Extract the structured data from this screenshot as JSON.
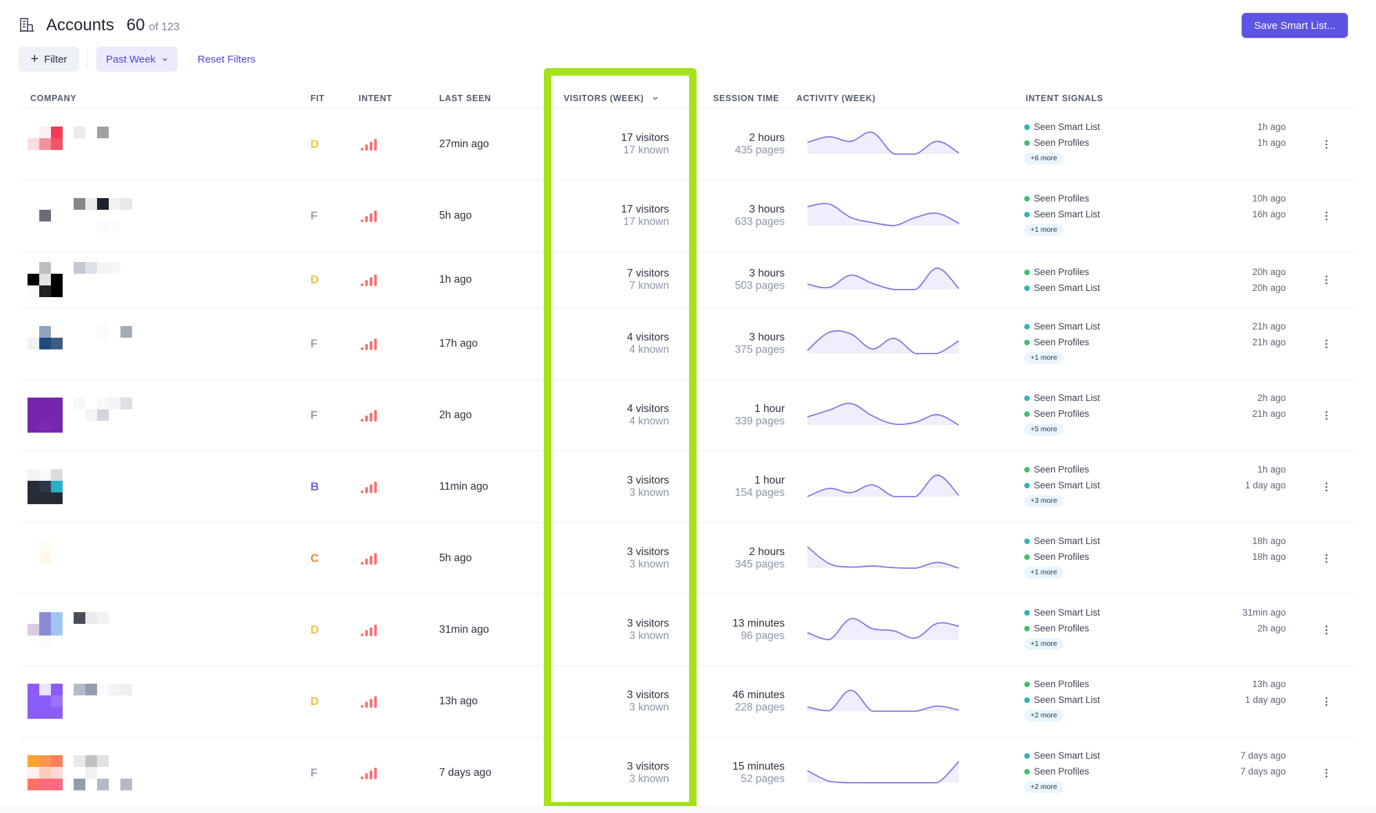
{
  "header": {
    "icon": "building-icon",
    "title": "Accounts",
    "count": "60",
    "count_of": "of 123",
    "save_button": "Save Smart List..."
  },
  "filters": {
    "add_filter_label": "Filter",
    "add_filter_icon": "plus-icon",
    "period_label": "Past Week",
    "period_icon": "chevron-down-icon",
    "reset_label": "Reset Filters"
  },
  "columns": {
    "company": "COMPANY",
    "fit": "FIT",
    "intent": "INTENT",
    "last_seen": "LAST SEEN",
    "visitors": "VISITORS (WEEK)",
    "session_time": "SESSION TIME",
    "activity": "ACTIVITY (WEEK)",
    "intent_signals": "INTENT SIGNALS"
  },
  "colors": {
    "accent": "#5d54e4",
    "highlight": "#a6e11e",
    "sparkline_line": "#7c78e6",
    "sparkline_fill": "#efeefc",
    "intent_bars": "#f87171",
    "fit_D": "#ecc53f",
    "fit_F": "#9aa3b2",
    "fit_B": "#6c63ea",
    "fit_C": "#ef8a3a",
    "signal_smart_list": "#2db5b5",
    "signal_profiles": "#3fbf6a"
  },
  "rows": [
    {
      "logo": [
        "#ffffff",
        "#fdeff1",
        "#f43a55",
        "#fbdce1",
        "#f58f9c",
        "#f25366",
        "#ffffff",
        "#ffffff",
        "#ffffff"
      ],
      "name": [
        "#eaebeb",
        "#ffffff",
        "#a0a1a5",
        "#ffffff",
        "#ffffff",
        "#ffffff",
        "#ffffff",
        "#ffffff",
        "#ffffff",
        "#ffffff",
        "#ffffff",
        "#ffffff",
        "#ffffff",
        "#ffffff",
        "#ffffff"
      ],
      "fit": "D",
      "last_seen": "27min ago",
      "visitors": "17 visitors",
      "known": "17 known",
      "session": "2 hours",
      "pages": "435 pages",
      "activity": [
        0.53,
        0.79,
        0.58,
        0.98,
        0,
        0,
        0.58,
        0.05
      ],
      "signals": [
        {
          "label": "Seen Smart List",
          "type": "smart_list",
          "when": "1h ago"
        },
        {
          "label": "Seen Profiles",
          "type": "profiles",
          "when": "1h ago"
        }
      ],
      "more": "+6 more"
    },
    {
      "logo": [
        "#ffffff",
        "#ffffff",
        "#ffffff",
        "#ffffff",
        "#6b6c78",
        "#ffffff",
        "#ffffff",
        "#ffffff",
        "#ffffff"
      ],
      "name": [
        "#86878c",
        "#eaebeb",
        "#1e2230",
        "#f0f1f3",
        "#e6e7e8",
        "#ffffff",
        "#ffffff",
        "#ffffff",
        "#ffffff",
        "#ffffff",
        "#ffffff",
        "#ffffff",
        "#fbfbfb",
        "#fbfcfb",
        "#ffffff"
      ],
      "fit": "F",
      "last_seen": "5h ago",
      "visitors": "17 visitors",
      "known": "17 known",
      "session": "3 hours",
      "pages": "633 pages",
      "activity": [
        0.86,
        0.98,
        0.37,
        0.14,
        0,
        0.37,
        0.56,
        0.1
      ],
      "signals": [
        {
          "label": "Seen Profiles",
          "type": "profiles",
          "when": "10h ago"
        },
        {
          "label": "Seen Smart List",
          "type": "smart_list",
          "when": "16h ago"
        }
      ],
      "more": "+1 more"
    },
    {
      "logo": [
        "#ffffff",
        "#bdbdbd",
        "#ffffff",
        "#000000",
        "#e3e3e3",
        "#000000",
        "#fbfbfb",
        "#222222",
        "#000000"
      ],
      "name": [
        "#c3c8d2",
        "#dfe0e5",
        "#f3f4f6",
        "#f6f6f8",
        "#ffffff",
        "#ffffff",
        "#ffffff",
        "#ffffff",
        "#ffffff",
        "#ffffff",
        "#ffffff",
        "#ffffff",
        "#ffffff",
        "#ffffff",
        "#ffffff"
      ],
      "fit": "D",
      "last_seen": "1h ago",
      "visitors": "7 visitors",
      "known": "7 known",
      "session": "3 hours",
      "pages": "503 pages",
      "activity": [
        0.25,
        0.1,
        0.65,
        0.28,
        0,
        0,
        0.97,
        0.04
      ],
      "signals": [
        {
          "label": "Seen Profiles",
          "type": "profiles",
          "when": "20h ago"
        },
        {
          "label": "Seen Smart List",
          "type": "smart_list",
          "when": "20h ago"
        }
      ],
      "more": ""
    },
    {
      "logo": [
        "#ffffff",
        "#90a4be",
        "#ffffff",
        "#eff2f5",
        "#1c4c7e",
        "#435a80",
        "#ffffff",
        "#ffffff",
        "#ffffff"
      ],
      "name": [
        "#ffffff",
        "#ffffff",
        "#fafafa",
        "#ffffff",
        "#a6acba",
        "#ffffff",
        "#ffffff",
        "#ffffff",
        "#ffffff",
        "#ffffff",
        "#ffffff",
        "#ffffff",
        "#ffffff",
        "#ffffff",
        "#ffffff"
      ],
      "fit": "F",
      "last_seen": "17h ago",
      "visitors": "4 visitors",
      "known": "4 known",
      "session": "3 hours",
      "pages": "375 pages",
      "activity": [
        0.14,
        0.96,
        0.89,
        0.21,
        0.69,
        0,
        0,
        0.58
      ],
      "signals": [
        {
          "label": "Seen Smart List",
          "type": "smart_list",
          "when": "21h ago"
        },
        {
          "label": "Seen Profiles",
          "type": "profiles",
          "when": "21h ago"
        }
      ],
      "more": "+1 more"
    },
    {
      "logo": [
        "#7626ae",
        "#7626ae",
        "#7626ae",
        "#7626ae",
        "#7626ae",
        "#7626ae",
        "#7626ae",
        "#7a2bb0",
        "#7626ae"
      ],
      "name": [
        "#f6f6f6",
        "#ffffff",
        "#f9f9fa",
        "#f3f4f6",
        "#dedfe4",
        "#ffffff",
        "#f3f4f6",
        "#d3d6de",
        "#ffffff",
        "#ffffff",
        "#ffffff",
        "#ffffff",
        "#ffffff",
        "#ffffff",
        "#ffffff"
      ],
      "fit": "F",
      "last_seen": "2h ago",
      "visitors": "4 visitors",
      "known": "4 known",
      "session": "1 hour",
      "pages": "339 pages",
      "activity": [
        0.37,
        0.68,
        0.98,
        0.42,
        0.05,
        0.13,
        0.47,
        0
      ],
      "signals": [
        {
          "label": "Seen Smart List",
          "type": "smart_list",
          "when": "2h ago"
        },
        {
          "label": "Seen Profiles",
          "type": "profiles",
          "when": "21h ago"
        }
      ],
      "more": "+5 more"
    },
    {
      "logo": [
        "#f3f3f3",
        "#f8f8f8",
        "#dadcdc",
        "#272b36",
        "#2c3a4e",
        "#29b0c9",
        "#272b36",
        "#272b36",
        "#272b36"
      ],
      "name": [
        "#ffffff",
        "#ffffff",
        "#ffffff",
        "#ffffff",
        "#ffffff",
        "#ffffff",
        "#ffffff",
        "#ffffff",
        "#ffffff",
        "#ffffff",
        "#ffffff",
        "#ffffff",
        "#ffffff",
        "#ffffff",
        "#ffffff"
      ],
      "fit": "B",
      "last_seen": "11min ago",
      "visitors": "3 visitors",
      "known": "3 known",
      "session": "1 hour",
      "pages": "154 pages",
      "activity": [
        0,
        0.37,
        0.18,
        0.53,
        0,
        0,
        0.97,
        0.05
      ],
      "signals": [
        {
          "label": "Seen Profiles",
          "type": "profiles",
          "when": "1h ago"
        },
        {
          "label": "Seen Smart List",
          "type": "smart_list",
          "when": "1 day ago"
        }
      ],
      "more": "+3 more"
    },
    {
      "logo": [
        "#ffffff",
        "#fffbee",
        "#ffffff",
        "#ffffff",
        "#fff7e9",
        "#ffffff",
        "#ffffff",
        "#ffffff",
        "#ffffff"
      ],
      "name": [
        "#ffffff",
        "#ffffff",
        "#ffffff",
        "#ffffff",
        "#ffffff",
        "#ffffff",
        "#ffffff",
        "#ffffff",
        "#ffffff",
        "#ffffff",
        "#ffffff",
        "#ffffff",
        "#ffffff",
        "#ffffff",
        "#ffffff"
      ],
      "fit": "C",
      "last_seen": "5h ago",
      "visitors": "3 visitors",
      "known": "3 known",
      "session": "2 hours",
      "pages": "345 pages",
      "activity": [
        0.97,
        0.21,
        0.05,
        0.1,
        0.02,
        0,
        0.26,
        0
      ],
      "signals": [
        {
          "label": "Seen Smart List",
          "type": "smart_list",
          "when": "18h ago"
        },
        {
          "label": "Seen Profiles",
          "type": "profiles",
          "when": "18h ago"
        }
      ],
      "more": "+1 more"
    },
    {
      "logo": [
        "#ffffff",
        "#8a8bd6",
        "#a0c6ee",
        "#dccbe4",
        "#8a8bd6",
        "#a0c6ee",
        "#ffffff",
        "#fafafb",
        "#ffffff"
      ],
      "name": [
        "#4b4d56",
        "#e9eaea",
        "#f2f2f2",
        "#ffffff",
        "#ffffff",
        "#ffffff",
        "#ffffff",
        "#ffffff",
        "#ffffff",
        "#ffffff",
        "#ffffff",
        "#ffffff",
        "#ffffff",
        "#ffffff",
        "#ffffff"
      ],
      "fit": "D",
      "last_seen": "31min ago",
      "visitors": "3 visitors",
      "known": "3 known",
      "session": "13 minutes",
      "pages": "96 pages",
      "activity": [
        0.32,
        0,
        0.95,
        0.5,
        0.4,
        0.08,
        0.74,
        0.61
      ],
      "signals": [
        {
          "label": "Seen Smart List",
          "type": "smart_list",
          "when": "31min ago"
        },
        {
          "label": "Seen Profiles",
          "type": "profiles",
          "when": "2h ago"
        }
      ],
      "more": "+1 more"
    },
    {
      "logo": [
        "#8b5cf6",
        "#e7e4fc",
        "#8b5cf6",
        "#8b5cf6",
        "#8b5cf6",
        "#9b72f7",
        "#8b5cf6",
        "#8b5cf6",
        "#8b5cf6"
      ],
      "name": [
        "#b4bac6",
        "#939daf",
        "#fbfbfb",
        "#f3f4f6",
        "#eef0f3",
        "#ffffff",
        "#ffffff",
        "#ffffff",
        "#ffffff",
        "#ffffff",
        "#ffffff",
        "#ffffff",
        "#ffffff",
        "#ffffff",
        "#ffffff"
      ],
      "fit": "D",
      "last_seen": "13h ago",
      "visitors": "3 visitors",
      "known": "3 known",
      "session": "46 minutes",
      "pages": "228 pages",
      "activity": [
        0.19,
        0.02,
        0.95,
        0,
        0,
        0,
        0.23,
        0.05
      ],
      "signals": [
        {
          "label": "Seen Profiles",
          "type": "profiles",
          "when": "13h ago"
        },
        {
          "label": "Seen Smart List",
          "type": "smart_list",
          "when": "1 day ago"
        }
      ],
      "more": "+2 more"
    },
    {
      "logo": [
        "#ffa130",
        "#ff9350",
        "#ff7f5c",
        "#fff1ec",
        "#fdccb8",
        "#fcd8d8",
        "#ff7264",
        "#ff6a80",
        "#ff6a80"
      ],
      "name": [
        "#e8e9ea",
        "#bfc1c5",
        "#e0e1e3",
        "#ffffff",
        "#ffffff",
        "#ffffff",
        "#f1f1f1",
        "#ffffff",
        "#ffffff",
        "#ffffff",
        "#939daf",
        "#ffffff",
        "#b4bac6",
        "#ffffff",
        "#b4bac6"
      ],
      "fit": "F",
      "last_seen": "7 days ago",
      "visitors": "3 visitors",
      "known": "3 known",
      "session": "15 minutes",
      "pages": "52 pages",
      "activity": [
        0.55,
        0.07,
        0,
        0,
        0,
        0,
        0,
        0.97
      ],
      "signals": [
        {
          "label": "Seen Smart List",
          "type": "smart_list",
          "when": "7 days ago"
        },
        {
          "label": "Seen Profiles",
          "type": "profiles",
          "when": "7 days ago"
        }
      ],
      "more": "+2 more"
    }
  ]
}
